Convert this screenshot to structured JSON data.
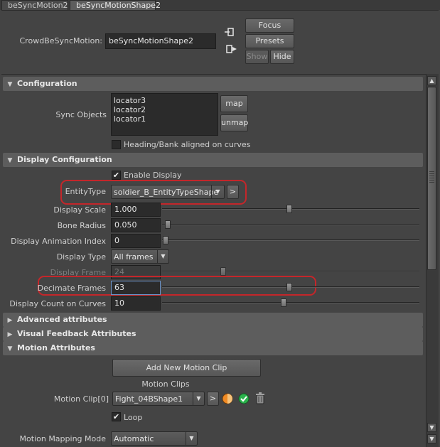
{
  "tabs": [
    "beSyncMotion2",
    "beSyncMotionShape2"
  ],
  "header": {
    "node_label": "CrowdBeSyncMotion:",
    "node_value": "beSyncMotionShape2",
    "focus": "Focus",
    "presets": "Presets",
    "show": "Show",
    "hide": "Hide"
  },
  "configuration": {
    "title": "Configuration",
    "sync_objects_label": "Sync Objects",
    "sync_objects": [
      "locator3",
      "locator2",
      "locator1"
    ],
    "map": "map",
    "unmap": "unmap",
    "heading_bank": "Heading/Bank aligned on curves"
  },
  "display": {
    "title": "Display Configuration",
    "enable_display": "Enable Display",
    "entity_type_label": "EntityType",
    "entity_type_value": "soldier_B_EntityTypeShape",
    "entity_type_nav": ">",
    "scale_label": "Display Scale",
    "scale_value": "1.000",
    "bone_label": "Bone Radius",
    "bone_value": "0.050",
    "anim_index_label": "Display Animation Index",
    "anim_index_value": "0",
    "type_label": "Display Type",
    "type_value": "All frames",
    "frame_label": "Display Frame",
    "frame_value": "24",
    "decimate_label": "Decimate Frames",
    "decimate_value": "63",
    "count_label": "Display Count on Curves",
    "count_value": "10"
  },
  "sections": {
    "advanced": "Advanced attributes",
    "visual": "Visual Feedback Attributes",
    "motion": "Motion Attributes"
  },
  "motion": {
    "add_clip": "Add New Motion Clip",
    "clips_heading": "Motion Clips",
    "clip_label": "Motion Clip[0]",
    "clip_value": "Fight_04BShape1",
    "clip_nav": ">",
    "loop": "Loop",
    "mapping_label": "Motion Mapping Mode",
    "mapping_value": "Automatic"
  },
  "sliders": {
    "scale": 0.5,
    "bone": 0.01,
    "anim_index": 0.0,
    "frame": 0.24,
    "decimate": 0.5,
    "count": 0.47
  },
  "colors": {
    "highlight": "#c4262a",
    "focus_field_border": "#6b93c9",
    "green_icon": "#2bb24c",
    "orange_icon": "#f08a24"
  }
}
